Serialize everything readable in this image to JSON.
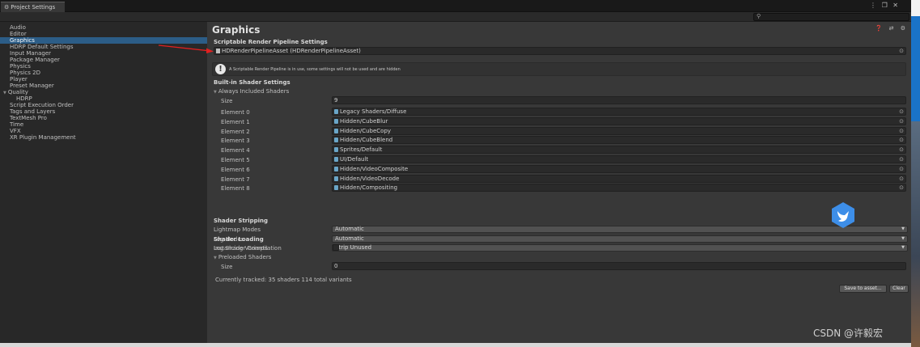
{
  "window": {
    "tab_title": "Project Settings",
    "controls": "⋮ ❐ ✕"
  },
  "search": {
    "placeholder": "",
    "value": ""
  },
  "sidebar": {
    "items": [
      {
        "label": "Audio",
        "kind": "item"
      },
      {
        "label": "Editor",
        "kind": "item"
      },
      {
        "label": "Graphics",
        "kind": "selected"
      },
      {
        "label": "HDRP Default Settings",
        "kind": "item"
      },
      {
        "label": "Input Manager",
        "kind": "item"
      },
      {
        "label": "Package Manager",
        "kind": "item"
      },
      {
        "label": "Physics",
        "kind": "item"
      },
      {
        "label": "Physics 2D",
        "kind": "item"
      },
      {
        "label": "Player",
        "kind": "item"
      },
      {
        "label": "Preset Manager",
        "kind": "item"
      },
      {
        "label": "Quality",
        "kind": "group"
      },
      {
        "label": "HDRP",
        "kind": "sub"
      },
      {
        "label": "Script Execution Order",
        "kind": "item"
      },
      {
        "label": "Tags and Layers",
        "kind": "item"
      },
      {
        "label": "TextMesh Pro",
        "kind": "item"
      },
      {
        "label": "Time",
        "kind": "item"
      },
      {
        "label": "VFX",
        "kind": "item"
      },
      {
        "label": "XR Plugin Management",
        "kind": "item"
      }
    ]
  },
  "main": {
    "title": "Graphics",
    "header_icons": "❓ ⇄ ⚙",
    "srp": {
      "heading": "Scriptable Render Pipeline Settings",
      "asset_value": "HDRenderPipelineAsset (HDRenderPipelineAsset)",
      "info_text": "A Scriptable Render Pipeline is in use, some settings will not be used and are hidden"
    },
    "builtin": {
      "heading": "Built-in Shader Settings",
      "always_included": "Always Included Shaders",
      "size_label": "Size",
      "size_value": "9",
      "elements": [
        {
          "label": "Element 0",
          "value": "Legacy Shaders/Diffuse"
        },
        {
          "label": "Element 1",
          "value": "Hidden/CubeBlur"
        },
        {
          "label": "Element 2",
          "value": "Hidden/CubeCopy"
        },
        {
          "label": "Element 3",
          "value": "Hidden/CubeBlend"
        },
        {
          "label": "Element 4",
          "value": "Sprites/Default"
        },
        {
          "label": "Element 5",
          "value": "UI/Default"
        },
        {
          "label": "Element 6",
          "value": "Hidden/VideoComposite"
        },
        {
          "label": "Element 7",
          "value": "Hidden/VideoDecode"
        },
        {
          "label": "Element 8",
          "value": "Hidden/Compositing"
        }
      ]
    },
    "stripping": {
      "heading": "Shader Stripping",
      "rows": [
        {
          "label": "Lightmap Modes",
          "value": "Automatic"
        },
        {
          "label": "Fog Modes",
          "value": "Automatic"
        },
        {
          "label": "Instancing Variants",
          "value": "Strip Unused"
        }
      ]
    },
    "loading": {
      "heading": "Shader Loading",
      "log_label": "Log Shader Compilation",
      "log_checked": false,
      "preloaded": "Preloaded Shaders",
      "size_label": "Size",
      "size_value": "0"
    },
    "tracked_text": "Currently tracked: 35 shaders 114 total variants",
    "save_button": "Save to asset...",
    "clear_button": "Clear"
  },
  "watermark": "CSDN @许毅宏",
  "colors": {
    "selection": "#2c5d87",
    "arrow": "#e02020",
    "logo": "#3d8ee8"
  }
}
